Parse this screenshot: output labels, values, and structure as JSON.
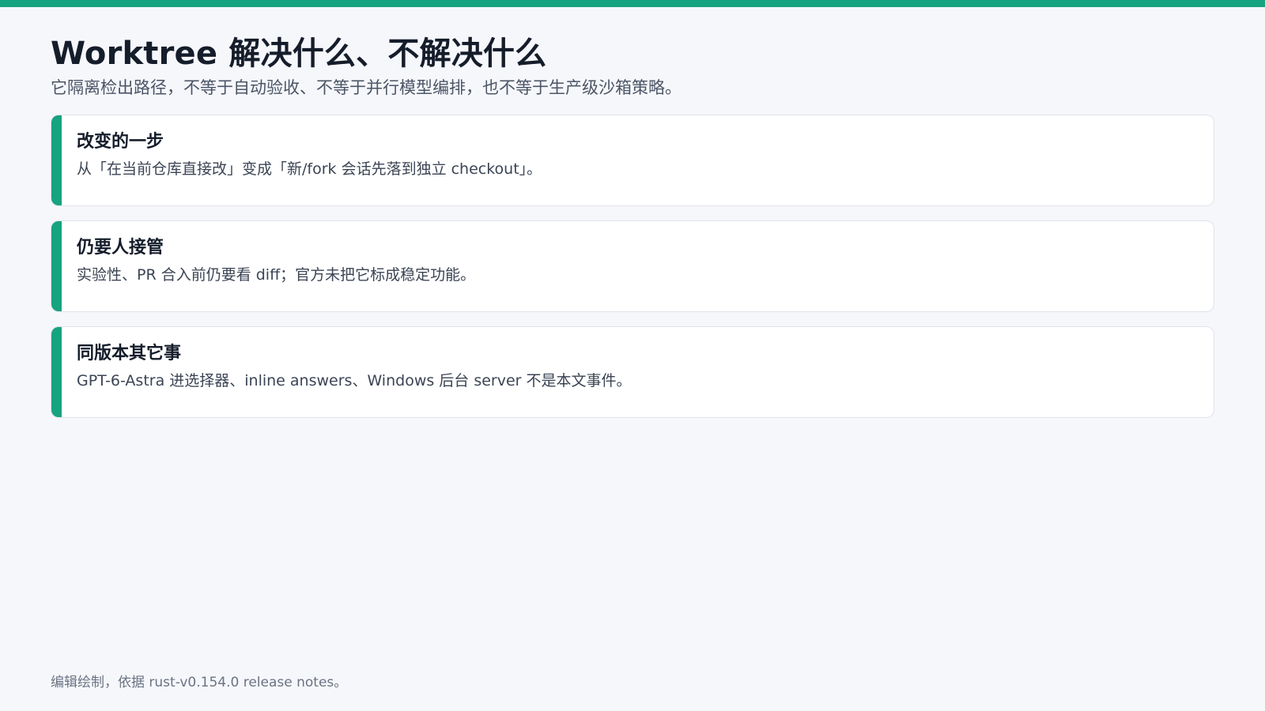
{
  "theme": {
    "accent": "#16a37f",
    "background": "#f6f7fb",
    "card_background": "#ffffff"
  },
  "header": {
    "title": "Worktree 解决什么、不解决什么",
    "subtitle": "它隔离检出路径，不等于自动验收、不等于并行模型编排，也不等于生产级沙箱策略。"
  },
  "cards": [
    {
      "title": "改变的一步",
      "text": "从「在当前仓库直接改」变成「新/fork 会话先落到独立 checkout」。"
    },
    {
      "title": "仍要人接管",
      "text": "实验性、PR 合入前仍要看 diff；官方未把它标成稳定功能。"
    },
    {
      "title": "同版本其它事",
      "text": "GPT-6-Astra 进选择器、inline answers、Windows 后台 server 不是本文事件。"
    }
  ],
  "footer": {
    "note": "编辑绘制，依据 rust-v0.154.0 release notes。"
  }
}
